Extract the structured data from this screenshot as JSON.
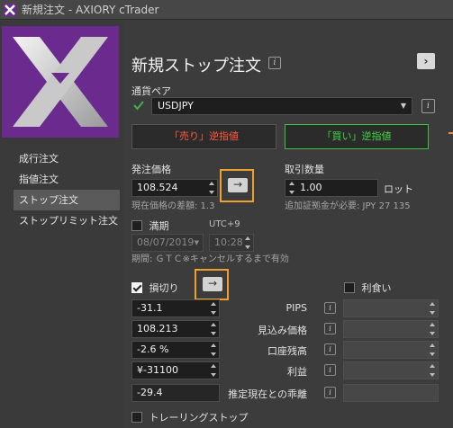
{
  "window": {
    "title": "新規注文 - AXIORY cTrader"
  },
  "nav": {
    "items": [
      {
        "label": "成行注文",
        "active": false
      },
      {
        "label": "指値注文",
        "active": false
      },
      {
        "label": "ストップ注文",
        "active": true
      },
      {
        "label": "ストップリミット注文",
        "active": false
      }
    ]
  },
  "header": {
    "title": "新規ストップ注文",
    "info_icon": "info-icon",
    "expand_icon": "chevron-right-icon"
  },
  "symbol": {
    "label": "通貨ペア",
    "value": "USDJPY",
    "favorite_icon": "check-mark-icon"
  },
  "trade_buttons": {
    "sell_label": "「売り」逆指値",
    "buy_label": "「買い」逆指値",
    "sell_color": "#ff5a3c",
    "buy_color": "#3fd63f"
  },
  "order_price": {
    "label": "発注価格",
    "value": "108.524",
    "note": "現在価格の差額: 1.3",
    "arrow": "→"
  },
  "quantity": {
    "label": "取引数量",
    "value": "1.00",
    "unit": "ロット",
    "note": "追加証拠金が必要: JPY 27 135"
  },
  "expiry": {
    "label": "満期",
    "timezone": "UTC+9",
    "date": "08/07/2019",
    "time": "10:28",
    "note": "期間: ＧＴＣ※キャンセルするまで有効"
  },
  "stop_loss": {
    "label": "損切り",
    "checked": true,
    "arrow": "→",
    "rows": [
      {
        "label": "PIPS",
        "value": "-31.1"
      },
      {
        "label": "見込み価格",
        "value": "108.213"
      },
      {
        "label": "口座残高",
        "value": "-2.6 %"
      },
      {
        "label": "利益",
        "value": "¥-31100"
      },
      {
        "label": "推定現在との乖離",
        "value": "-29.4"
      }
    ]
  },
  "take_profit": {
    "label": "利食い",
    "checked": false
  },
  "trailing_stop": {
    "label": "トレーリングストップ",
    "checked": false
  },
  "colors": {
    "highlight": "#f0a030",
    "logo_bg": "#6a2a8e"
  }
}
